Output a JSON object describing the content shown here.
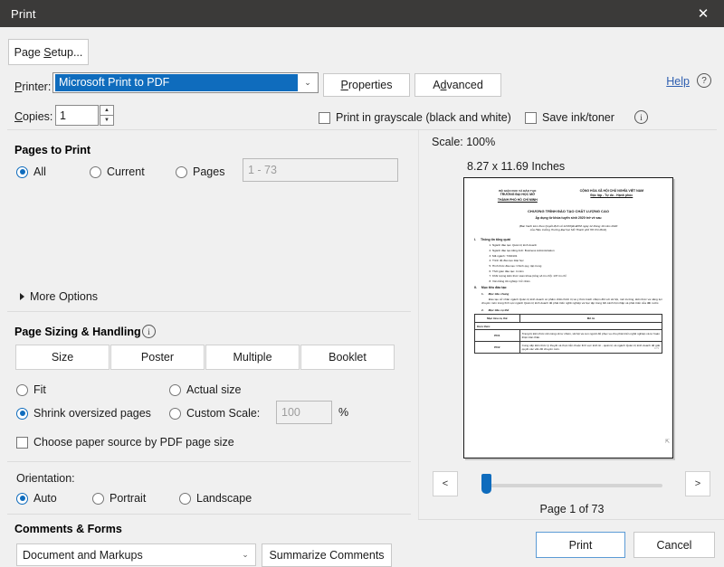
{
  "window": {
    "title": "Print",
    "close_icon": "close-icon"
  },
  "printer": {
    "label": "Printer:",
    "selected": "Microsoft Print to PDF",
    "chevron": "⌄",
    "properties_label": "Properties",
    "advanced_label": "Advanced",
    "help_label": "Help",
    "help_icon": "?",
    "info_icon": "i"
  },
  "copies": {
    "label": "Copies:",
    "value": "1",
    "up_icon": "▲",
    "down_icon": "▼"
  },
  "options": {
    "grayscale_label": "Print in grayscale (black and white)",
    "grayscale_checked": false,
    "save_ink_label": "Save ink/toner",
    "save_ink_checked": false
  },
  "pages_to_print": {
    "title": "Pages to Print",
    "radios": [
      {
        "label": "All",
        "selected": true
      },
      {
        "label": "Current",
        "selected": false
      },
      {
        "label": "Pages",
        "selected": false
      }
    ],
    "range_placeholder": "1 - 73",
    "more_options_label": "More Options",
    "more_options_icon": "triangle-right-icon"
  },
  "page_sizing": {
    "title": "Page Sizing & Handling",
    "info_icon": "i",
    "tabs": [
      {
        "label": "Size"
      },
      {
        "label": "Poster"
      },
      {
        "label": "Multiple"
      },
      {
        "label": "Booklet"
      }
    ],
    "radios": [
      {
        "label": "Fit",
        "selected": false
      },
      {
        "label": "Actual size",
        "selected": false
      },
      {
        "label": "Shrink oversized pages",
        "selected": true
      },
      {
        "label": "Custom Scale:",
        "selected": false
      }
    ],
    "custom_scale_value": "100",
    "percent_label": "%",
    "paper_source_label": "Choose paper source by PDF page size",
    "paper_source_checked": false
  },
  "orientation": {
    "title": "Orientation:",
    "radios": [
      {
        "label": "Auto",
        "selected": true
      },
      {
        "label": "Portrait",
        "selected": false
      },
      {
        "label": "Landscape",
        "selected": false
      }
    ]
  },
  "comments_forms": {
    "title": "Comments & Forms",
    "selected": "Document and Markups",
    "chevron": "⌄",
    "summarize_label": "Summarize Comments"
  },
  "preview": {
    "scale_label": "Scale: 100%",
    "dimensions_label": "8.27 x 11.69 Inches",
    "prev_icon": "<",
    "next_icon": ">",
    "page_status": "Page 1 of 73",
    "slider_position_pct": 0,
    "document": {
      "header_left": [
        "BỘ GIÁO DỤC VÀ ĐÀO TẠO",
        "TRƯỜNG ĐẠI HỌC MỞ",
        "THÀNH PHỐ HỒ CHÍ MINH"
      ],
      "header_right": [
        "CỘNG HÒA XÃ HỘI CHỦ NGHĨA VIỆT NAM",
        "Độc lập - Tự do - Hạnh phúc"
      ],
      "title": "CHƯƠNG TRÌNH ĐÀO TẠO CHẤT LƯỢNG CAO",
      "subtitle": "Áp dụng từ khóa tuyển sinh 2020 trở về sau",
      "note_line1": "(Ban hành kèm theo Quyết định số 1233/QĐ-ĐHM ngày 12 tháng 10 năm 2020",
      "note_line2": "của Hiệu trưởng Trường Đại học Mở Thành phố Hồ Chí Minh)",
      "section1_number": "I.",
      "section1_title": "Thông tin tổng quát",
      "section1_items": [
        "Ngành đào tạo: Quản trị kinh doanh",
        "Ngành đào tạo tiếng Anh: Business Administration",
        "Mã ngành: 7340101",
        "Trình độ đào tạo: Đại học",
        "Hình thức đào tạo: Chính quy, tập trung",
        "Thời gian đào tạo: 4 năm",
        "Khối lượng kiến thức toàn khóa (tổng số tín chỉ): 137 tín chỉ",
        "Văn bằng tốt nghiệp: Cử nhân"
      ],
      "section2_number": "II.",
      "section2_title": "Mục tiêu đào tạo",
      "sub1_number": "1.",
      "sub1_title": "Mục tiêu chung",
      "sub1_paragraph": "Đào tạo cử nhân ngành Quản trị kinh doanh có phẩm chất chính trị và ý thức trách nhiệm đối với xã hội, môi trường, kiến thức và năng lực chuyên môn trong lĩnh vực ngành Quản trị kinh doanh để phát triển nghề nghiệp và học tập trong bối cảnh hội nhập và phát triển của đất nước.",
      "sub2_number": "2.",
      "sub2_title": "Mục tiêu cụ thể",
      "table": {
        "headers": [
          "Mục tiêu cụ thể",
          "Mô tả"
        ],
        "group_row": "Kiến thức",
        "rows": [
          {
            "code": "PO1",
            "desc": "Trang bị kiến thức nền tảng về tự nhiên, xã hội và con người để phục vụ cho phát triển nghề nghiệp và tự hoàn thiện bản thân."
          },
          {
            "code": "PO2",
            "desc": "Cung cấp kiến thức lý thuyết và thực tiễn thuộc lĩnh vực kinh tế - quản trị và ngành Quản trị kinh doanh để giải quyết các vấn đề chuyên môn."
          }
        ]
      },
      "page_footer": "1/73"
    }
  },
  "footer": {
    "page_setup_label": "Page Setup...",
    "print_label": "Print",
    "cancel_label": "Cancel"
  }
}
